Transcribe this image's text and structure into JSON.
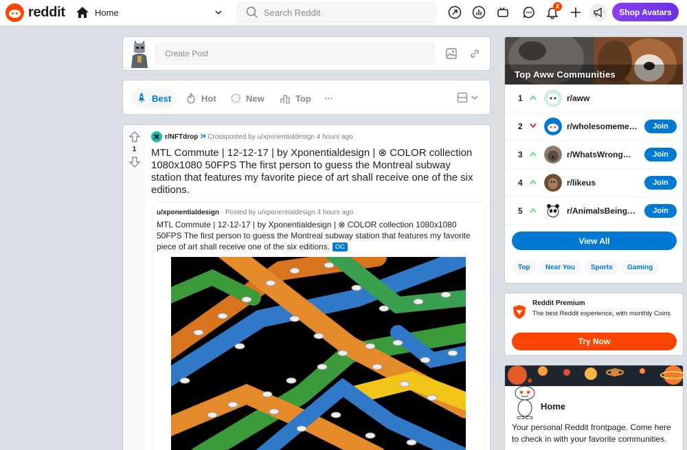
{
  "header": {
    "logo_text": "reddit",
    "home_label": "Home",
    "search_placeholder": "Search Reddit",
    "notification_count": "2",
    "shop_label": "Shop Avatars"
  },
  "create_post": {
    "placeholder": "Create Post"
  },
  "sort": {
    "items": [
      {
        "label": "Best",
        "icon": "rocket-icon",
        "active": true
      },
      {
        "label": "Hot",
        "icon": "flame-icon",
        "active": false
      },
      {
        "label": "New",
        "icon": "sparkle-icon",
        "active": false
      },
      {
        "label": "Top",
        "icon": "top-chart-icon",
        "active": false
      }
    ],
    "more": "···"
  },
  "post": {
    "votes": "1",
    "subreddit": "r/NFTdrop",
    "crosspost_text": "Crossposted by u/xponentialdesign 4 hours ago",
    "title": "MTL Commute | 12-12-17 | by Xponentialdesign | ⊗ COLOR collection 1080x1080 50FPS The first person to guess the Montreal subway station that features my favorite piece of art shall receive one of the six editions.",
    "crosspost": {
      "author": "u/xponentialdesign",
      "meta": "· Posted by u/xponentialdesign 4 hours ago",
      "title": "MTL Commute | 12-12-17 | by Xponentialdesign | ⊗ COLOR collection 1080x1080 50FPS The first person to guess the Montreal subway station that features my favorite piece of art shall receive one of the six editions.",
      "flair": "OC"
    }
  },
  "communities": {
    "title": "Top  Aww  Communities",
    "rows": [
      {
        "rank": "1",
        "name": "r/aww",
        "trend": "up",
        "join": ""
      },
      {
        "rank": "2",
        "name": "r/wholesomememes",
        "trend": "down",
        "join": "Join"
      },
      {
        "rank": "3",
        "name": "r/WhatsWrongWithYourDog",
        "trend": "up",
        "join": "Join"
      },
      {
        "rank": "4",
        "name": "r/likeus",
        "trend": "up",
        "join": "Join"
      },
      {
        "rank": "5",
        "name": "r/AnimalsBeingJerks",
        "trend": "up",
        "join": "Join"
      }
    ],
    "view_all": "View All",
    "chips": [
      "Top",
      "Near You",
      "Sports",
      "Gaming"
    ]
  },
  "premium": {
    "title": "Reddit Premium",
    "description": "The best Reddit experience, with monthly Coins",
    "button": "Try Now"
  },
  "home_card": {
    "title": "Home",
    "description": "Your personal Reddit frontpage. Come here to check in with your favorite communities."
  },
  "colors": {
    "brand": "#ff4500",
    "accent": "#0079d3",
    "shop": "#7c3aed",
    "upvote_trend": "#46d160",
    "downvote_trend": "#ea0027"
  }
}
